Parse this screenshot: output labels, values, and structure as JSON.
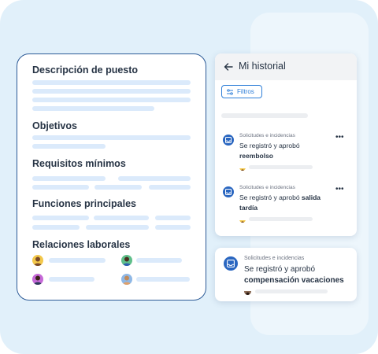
{
  "document": {
    "sections": [
      {
        "title": "Descripción de puesto"
      },
      {
        "title": "Objetivos"
      },
      {
        "title": "Requisitos mínimos"
      },
      {
        "title": "Funciones principales"
      },
      {
        "title": "Relaciones laborales"
      }
    ]
  },
  "history": {
    "title": "Mi historial",
    "filter_label": "Filtros",
    "events": [
      {
        "category": "Solicitudes e incidencias",
        "text": "Se registró y aprobó ",
        "highlight": "reembolso"
      },
      {
        "category": "Solicitudes e incidencias",
        "text": "Se registró y aprobó ",
        "highlight": "salida tardía"
      }
    ]
  },
  "floating_event": {
    "category": "Solicitudes e incidencias",
    "text": "Se registró y aprobó",
    "highlight": "compensación vacaciones"
  },
  "icons": {
    "back": "arrow-left-icon",
    "filter": "sliders-icon",
    "event": "inbox-icon",
    "more": "more-horizontal-icon"
  },
  "colors": {
    "accent": "#2f7fd8",
    "icon_bg": "#2a66c0",
    "card_border": "#2c5a96",
    "placeholder": "#dbeafb",
    "background": "#e1f0fa"
  }
}
